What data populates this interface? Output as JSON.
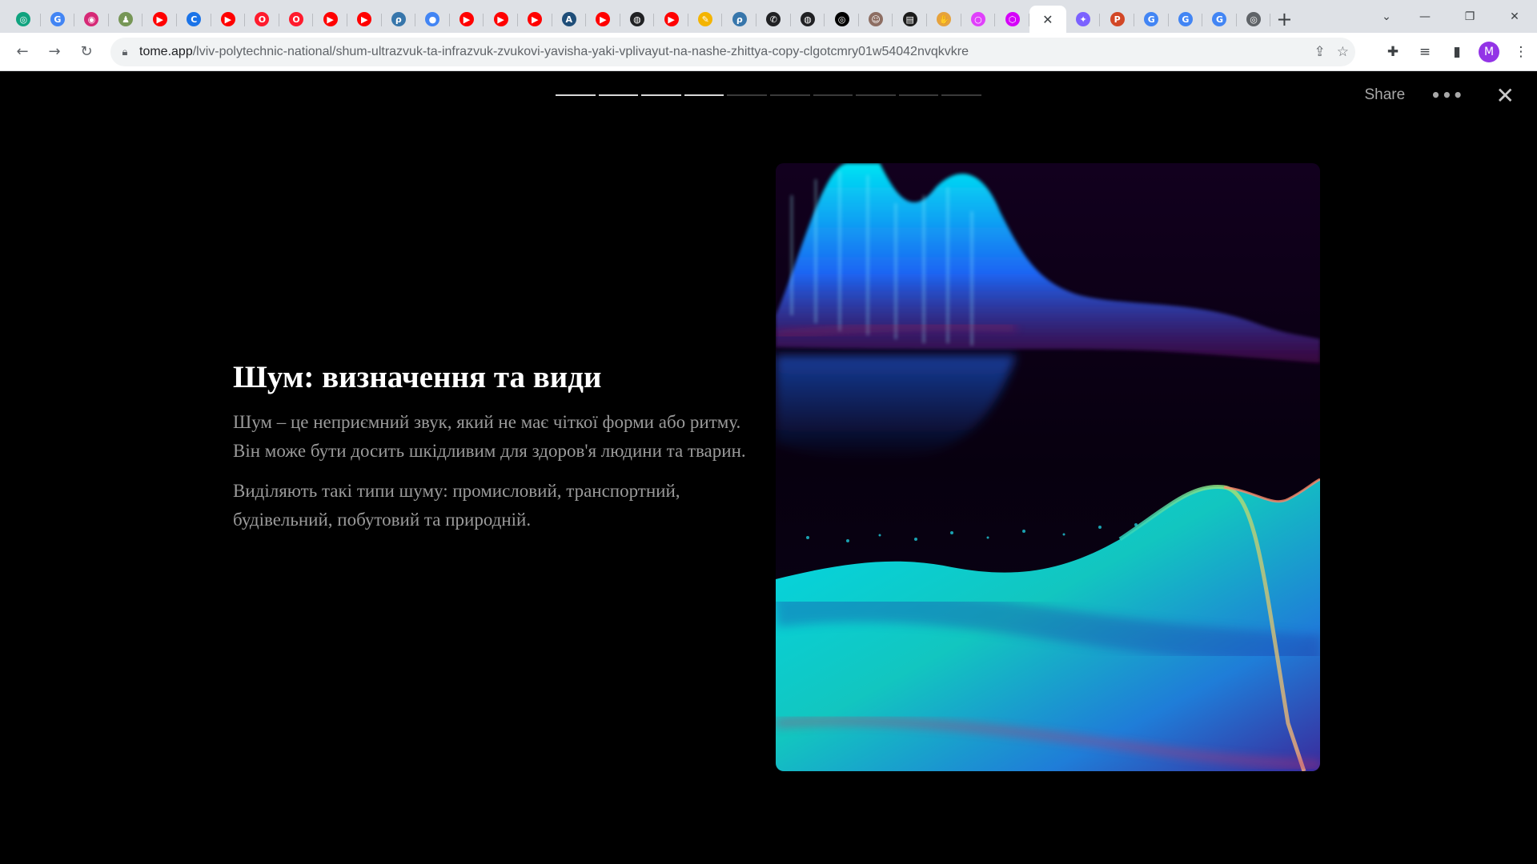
{
  "browser": {
    "tabs": [
      {
        "icon": "chatgpt-icon",
        "color": "#10a37f",
        "glyph": "◎"
      },
      {
        "icon": "google-translate-icon",
        "color": "#4285f4",
        "glyph": "G"
      },
      {
        "icon": "instagram-icon",
        "color": "#d62976",
        "glyph": "◉"
      },
      {
        "icon": "chess-icon",
        "color": "#769656",
        "glyph": "♟"
      },
      {
        "icon": "youtube-icon",
        "color": "#ff0000",
        "glyph": "▶"
      },
      {
        "icon": "c-app-icon",
        "color": "#1a73e8",
        "glyph": "C"
      },
      {
        "icon": "youtube-icon",
        "color": "#ff0000",
        "glyph": "▶"
      },
      {
        "icon": "opera-icon",
        "color": "#ff1b2d",
        "glyph": "O"
      },
      {
        "icon": "opera-icon",
        "color": "#ff1b2d",
        "glyph": "O"
      },
      {
        "icon": "youtube-icon",
        "color": "#ff0000",
        "glyph": "▶"
      },
      {
        "icon": "youtube-icon",
        "color": "#ff0000",
        "glyph": "▶"
      },
      {
        "icon": "python-icon",
        "color": "#3776ab",
        "glyph": "ρ"
      },
      {
        "icon": "map-pin-icon",
        "color": "#4285f4",
        "glyph": "●"
      },
      {
        "icon": "youtube-icon",
        "color": "#ff0000",
        "glyph": "▶"
      },
      {
        "icon": "youtube-icon",
        "color": "#ff0000",
        "glyph": "▶"
      },
      {
        "icon": "youtube-icon",
        "color": "#ff0000",
        "glyph": "▶"
      },
      {
        "icon": "ai-app-icon",
        "color": "#1f4e79",
        "glyph": "A"
      },
      {
        "icon": "youtube-icon",
        "color": "#ff0000",
        "glyph": "▶"
      },
      {
        "icon": "globe-icon",
        "color": "#202124",
        "glyph": "◍"
      },
      {
        "icon": "youtube-icon",
        "color": "#ff0000",
        "glyph": "▶"
      },
      {
        "icon": "pen-icon",
        "color": "#f4b400",
        "glyph": "✎"
      },
      {
        "icon": "python-icon",
        "color": "#3776ab",
        "glyph": "ρ"
      },
      {
        "icon": "phone-icon",
        "color": "#202124",
        "glyph": "✆"
      },
      {
        "icon": "globe-icon",
        "color": "#202124",
        "glyph": "◍"
      },
      {
        "icon": "circle-logo-icon",
        "color": "#000000",
        "glyph": "◎"
      },
      {
        "icon": "avatar-icon",
        "color": "#8d6e63",
        "glyph": "☺"
      },
      {
        "icon": "terminal-icon",
        "color": "#1b1b1b",
        "glyph": "▤"
      },
      {
        "icon": "hand-icon",
        "color": "#e6a23c",
        "glyph": "✋"
      },
      {
        "icon": "ring-icon",
        "color": "#e040fb",
        "glyph": "○"
      },
      {
        "icon": "hexagon-icon",
        "color": "#d500f9",
        "glyph": "⬡"
      }
    ],
    "tabs_after": [
      {
        "icon": "copilot-icon",
        "color": "#7b61ff",
        "glyph": "✦"
      },
      {
        "icon": "powerpoint-icon",
        "color": "#d24726",
        "glyph": "P"
      },
      {
        "icon": "google-icon",
        "color": "#4285f4",
        "glyph": "G"
      },
      {
        "icon": "google-icon",
        "color": "#4285f4",
        "glyph": "G"
      },
      {
        "icon": "google-icon",
        "color": "#4285f4",
        "glyph": "G"
      },
      {
        "icon": "chrome-icon",
        "color": "#5f6368",
        "glyph": "◎"
      }
    ],
    "url_host": "tome.app",
    "url_path": "/lviv-polytechnic-national/shum-ultrazvuk-ta-infrazvuk-zvukovi-yavisha-yaki-vplivayut-na-nashe-zhittya-copy-clgotcmry01w54042nvqkvkre",
    "profile_initial": "M"
  },
  "presentation": {
    "progress": {
      "total": 10,
      "current": 4
    },
    "share_label": "Share",
    "title": "Шум: визначення та види",
    "paragraphs": [
      "Шум – це неприємний звук, який не має чіткої форми або ритму. Він може бути досить шкідливим для здоров'я людини та тварин.",
      "Виділяють такі типи шуму: промисловий, транспортний, будівельний, побутовий та природній."
    ],
    "colors": {
      "background": "#000000",
      "title": "#ffffff",
      "body_text": "#9a9a9a",
      "accent_cyan": "#00e5ff",
      "accent_blue": "#1e88ff"
    }
  }
}
